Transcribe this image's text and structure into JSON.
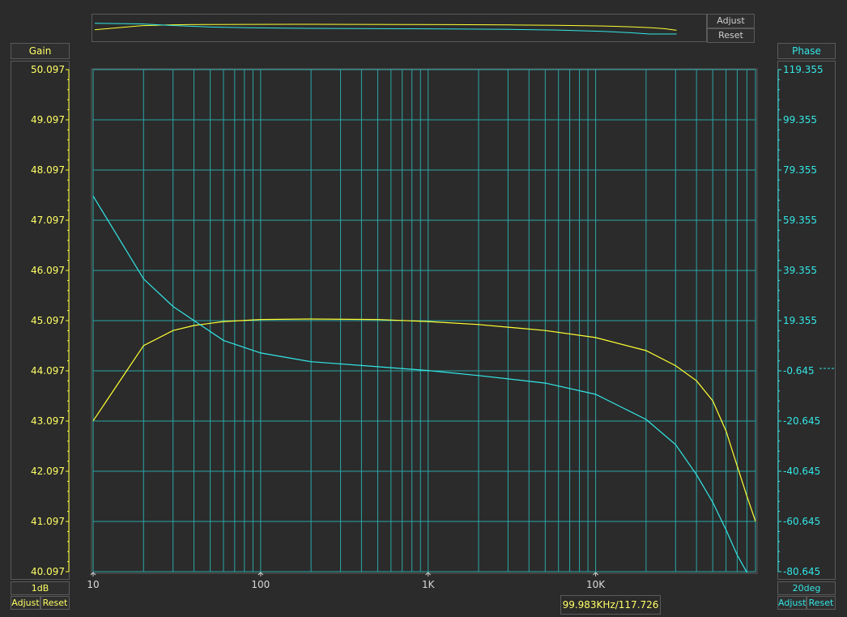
{
  "overview": {
    "adjust_label": "Adjust",
    "reset_label": "Reset"
  },
  "gain_panel": {
    "title": "Gain",
    "scale_label": "1dB",
    "adjust_label": "Adjust",
    "reset_label": "Reset"
  },
  "phase_panel": {
    "title": "Phase",
    "scale_label": "20deg",
    "adjust_label": "Adjust",
    "reset_label": "Reset"
  },
  "cursor_readout": "99.983KHz/117.726",
  "colors": {
    "gain": "#ffff33",
    "phase": "#33e6e6",
    "grid": "#2aa7a7",
    "text_gain": "#ffff66",
    "text_phase": "#33e6e6",
    "background": "#2b2b2b"
  },
  "chart_data": {
    "type": "line",
    "x_scale": "log",
    "xlim": [
      10,
      90000
    ],
    "x_ticks": [
      {
        "value": 10,
        "label": "10"
      },
      {
        "value": 100,
        "label": "100"
      },
      {
        "value": 1000,
        "label": "1K"
      },
      {
        "value": 10000,
        "label": "10K"
      }
    ],
    "grid": true,
    "gain_axis": {
      "side": "left",
      "ylim": [
        40.097,
        50.097
      ],
      "tick_labels": [
        "50.097",
        "49.097",
        "48.097",
        "47.097",
        "46.097",
        "45.097",
        "44.097",
        "43.097",
        "42.097",
        "41.097",
        "40.097"
      ]
    },
    "phase_axis": {
      "side": "right",
      "ylim": [
        -80.645,
        119.355
      ],
      "tick_labels": [
        "119.355",
        "99.355",
        "79.355",
        "59.355",
        "39.355",
        "19.355",
        "-0.645",
        "-20.645",
        "-40.645",
        "-60.645",
        "-80.645"
      ]
    },
    "series": [
      {
        "axis": "gain",
        "color": "#ffff33",
        "x": [
          10,
          20,
          30,
          40,
          60,
          100,
          200,
          500,
          1000,
          2000,
          5000,
          10000,
          20000,
          30000,
          40000,
          50000,
          60000,
          70000,
          80000,
          90000
        ],
        "values": [
          43.1,
          44.6,
          44.9,
          45.0,
          45.08,
          45.12,
          45.13,
          45.12,
          45.08,
          45.02,
          44.9,
          44.76,
          44.5,
          44.2,
          43.9,
          43.5,
          42.9,
          42.2,
          41.6,
          41.1
        ]
      },
      {
        "axis": "phase",
        "color": "#33e6e6",
        "x": [
          10,
          20,
          30,
          40,
          60,
          100,
          200,
          500,
          1000,
          2000,
          5000,
          10000,
          20000,
          30000,
          40000,
          50000,
          60000,
          70000,
          80000
        ],
        "values": [
          69,
          36,
          25,
          19.4,
          11.5,
          6.5,
          3,
          1,
          -0.5,
          -2.5,
          -5.5,
          -10,
          -20,
          -30,
          -42,
          -53,
          -64,
          -74,
          -81
        ]
      }
    ]
  }
}
